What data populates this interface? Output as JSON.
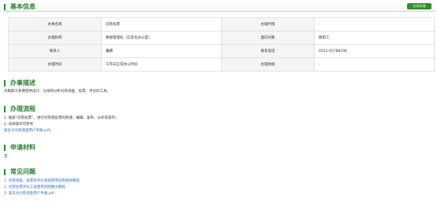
{
  "basic": {
    "title": "基本信息",
    "online_button": "在线办理",
    "rows": [
      {
        "l1": "办事名称",
        "v1": "问卷投票",
        "l2": "办理时限",
        "v2": "-"
      },
      {
        "l1": "办理机构",
        "v1": "数据管理处（信息化办公室）",
        "l2": "面向对象",
        "v2": "教职工"
      },
      {
        "l1": "联系人",
        "v1": "董麟",
        "l2": "联系电话",
        "v2": "0551-65788196"
      },
      {
        "l1": "办理时间",
        "v1": "工作日正常办公时间",
        "l2": "办理依据",
        "v2": "-"
      }
    ]
  },
  "description": {
    "title": "办事描述",
    "text": "为教职工免费提供设计、分发和分析问卷调查、投票、评比的工具。"
  },
  "process": {
    "title": "办理流程",
    "steps": [
      "1. 搜索“问卷投票”，进行问卷或投票的新建、编辑、发布、分析等操作；",
      "2. 具体操作可参考"
    ],
    "link": "安农大问卷调查用户手册.pdf",
    "link_suffix": "。"
  },
  "materials": {
    "title": "申请材料",
    "text": "无"
  },
  "faq": {
    "title": "常见问题",
    "items": [
      "1. 问卷调查、投票及评比系统使用说明视频教程",
      "2. 问卷投票评比工具使用说明图文教程",
      "3. 安农大问卷调查用户手册.pdf"
    ]
  },
  "colors": {
    "accent": "#2e8b2e",
    "heading": "#2e7d32",
    "link": "#2b6cd2"
  }
}
